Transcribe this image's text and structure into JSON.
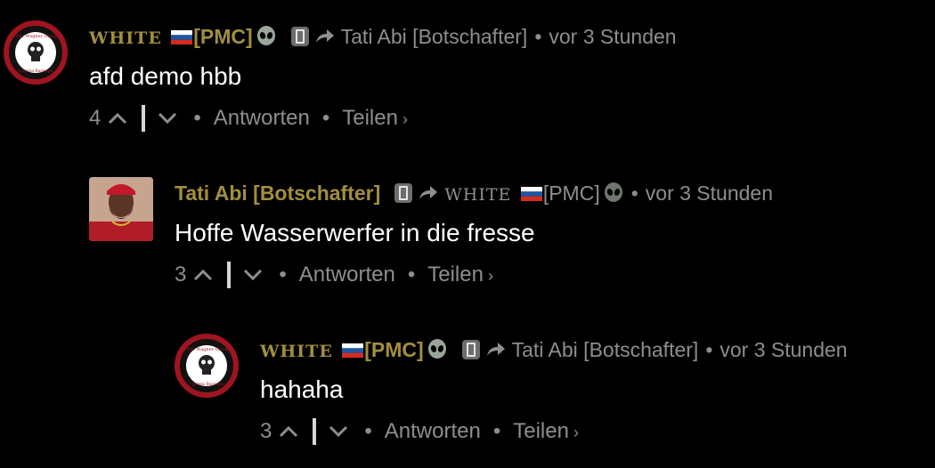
{
  "comments": [
    {
      "author": {
        "prefix": "WHITE",
        "name": "[PMC]"
      },
      "reply_to": "Tati Abi [Botschafter]",
      "time": "vor 3 Stunden",
      "text": "afd demo hbb",
      "votes": "4",
      "reply_label": "Antworten",
      "share_label": "Teilen"
    },
    {
      "author": {
        "name": "Tati Abi [Botschafter]"
      },
      "reply_to": {
        "prefix": "WHITE",
        "name": "[PMC]"
      },
      "time": "vor 3 Stunden",
      "text": "Hoffe Wasserwerfer in die fresse",
      "votes": "3",
      "reply_label": "Antworten",
      "share_label": "Teilen"
    },
    {
      "author": {
        "prefix": "WHITE",
        "name": "[PMC]"
      },
      "reply_to": "Tati Abi [Botschafter]",
      "time": "vor 3 Stunden",
      "text": "hahaha",
      "votes": "3",
      "reply_label": "Antworten",
      "share_label": "Teilen"
    }
  ],
  "logo_text": {
    "top": "PMC Wagner Group",
    "bottom": "Группа Вагнера"
  },
  "colors": {
    "background": "#000000",
    "gold": "#a28f3d",
    "muted": "#8e8e8e",
    "text": "#ffffff"
  },
  "icons": [
    "wagner-logo",
    "russia-flag-icon",
    "alien-icon",
    "moderator-badge-icon",
    "reply-arrow-icon",
    "upvote-icon",
    "downvote-icon",
    "chevron-right-icon"
  ]
}
